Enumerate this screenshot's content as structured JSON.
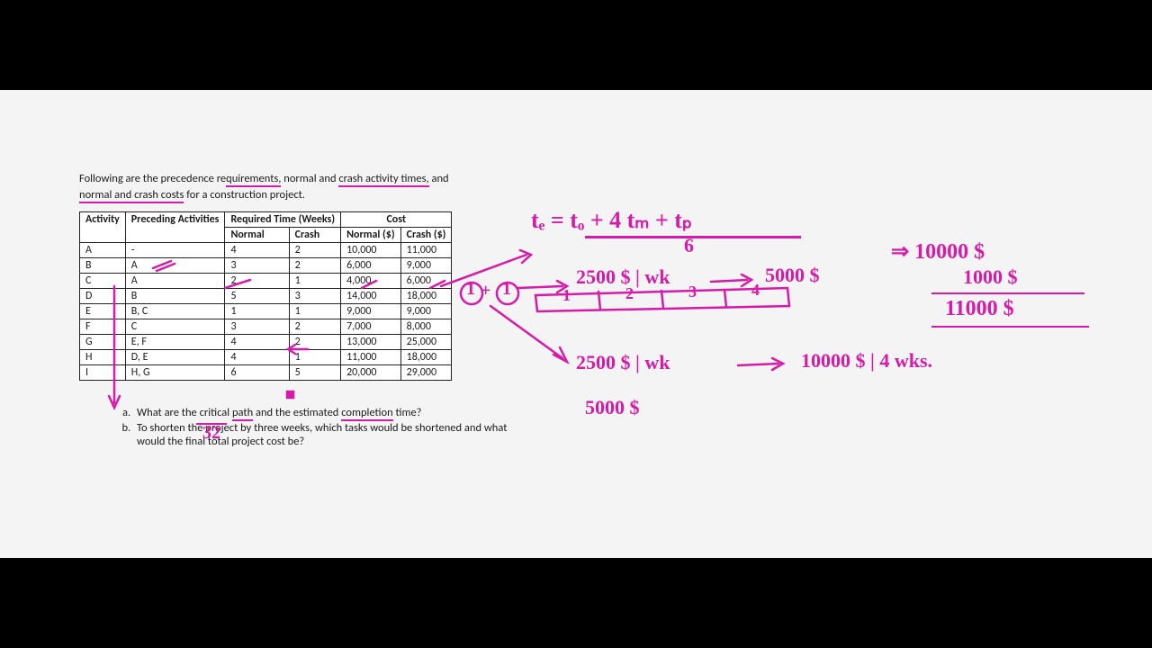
{
  "intro": {
    "line1_a": "Following are the precedence re",
    "line1_b": "quirements,",
    "line1_c": " normal and ",
    "line1_d": "crash activity times,",
    "line1_e": " and",
    "line2_a": "normal and crash costs",
    "line2_b": " for a construction project."
  },
  "table": {
    "h_activity": "Activity",
    "h_preceding": "Preceding Activities",
    "h_reqtime": "Required Time (Weeks)",
    "h_cost": "Cost",
    "h_normal": "Normal",
    "h_crash": "Crash",
    "h_normcost": "Normal ($)",
    "h_crashcost": "Crash ($)",
    "rows": [
      {
        "act": "A",
        "pre": "-",
        "n": "4",
        "c": "2",
        "nc": "10,000",
        "cc": "11,000"
      },
      {
        "act": "B",
        "pre": "A",
        "n": "3",
        "c": "2",
        "nc": "6,000",
        "cc": "9,000"
      },
      {
        "act": "C",
        "pre": "A",
        "n": "2",
        "c": "1",
        "nc": "4,000",
        "cc": "6,000"
      },
      {
        "act": "D",
        "pre": "B",
        "n": "5",
        "c": "3",
        "nc": "14,000",
        "cc": "18,000"
      },
      {
        "act": "E",
        "pre": "B, C",
        "n": "1",
        "c": "1",
        "nc": "9,000",
        "cc": "9,000"
      },
      {
        "act": "F",
        "pre": "C",
        "n": "3",
        "c": "2",
        "nc": "7,000",
        "cc": "8,000"
      },
      {
        "act": "G",
        "pre": "E, F",
        "n": "4",
        "c": "2",
        "nc": "13,000",
        "cc": "25,000"
      },
      {
        "act": "H",
        "pre": "D, E",
        "n": "4",
        "c": "1",
        "nc": "11,000",
        "cc": "18,000"
      },
      {
        "act": "I",
        "pre": "H, G",
        "n": "6",
        "c": "5",
        "nc": "20,000",
        "cc": "29,000"
      }
    ]
  },
  "questions": {
    "a_1": "What are the critical ",
    "a_2": "path",
    "a_3": " and the estimated ",
    "a_4": "completion",
    "a_5": " time?",
    "b": "To shorten the project by three weeks, which tasks would be shortened and what would the final total project cost be?"
  },
  "hand": {
    "formula": "tₑ = (tₒ + 4 tₘ + tₚ) / 6",
    "formula_top": "tₑ =  tₒ + 4 tₘ + tₚ",
    "formula_bot": "6",
    "line2a": "2500 $ | wk",
    "line2b": "5000 $",
    "line2c": "⇒ 10000 $",
    "col_1000": "1000 $",
    "col_11000": "11000 $",
    "bar_lbls": [
      "1",
      "2",
      "3",
      "4"
    ],
    "line3a": "2500 $ | wk",
    "line3b": "10000 $ | 4 wks.",
    "line4": "5000 $",
    "sum32": "32",
    "onep": "1",
    "onep2": "1"
  }
}
